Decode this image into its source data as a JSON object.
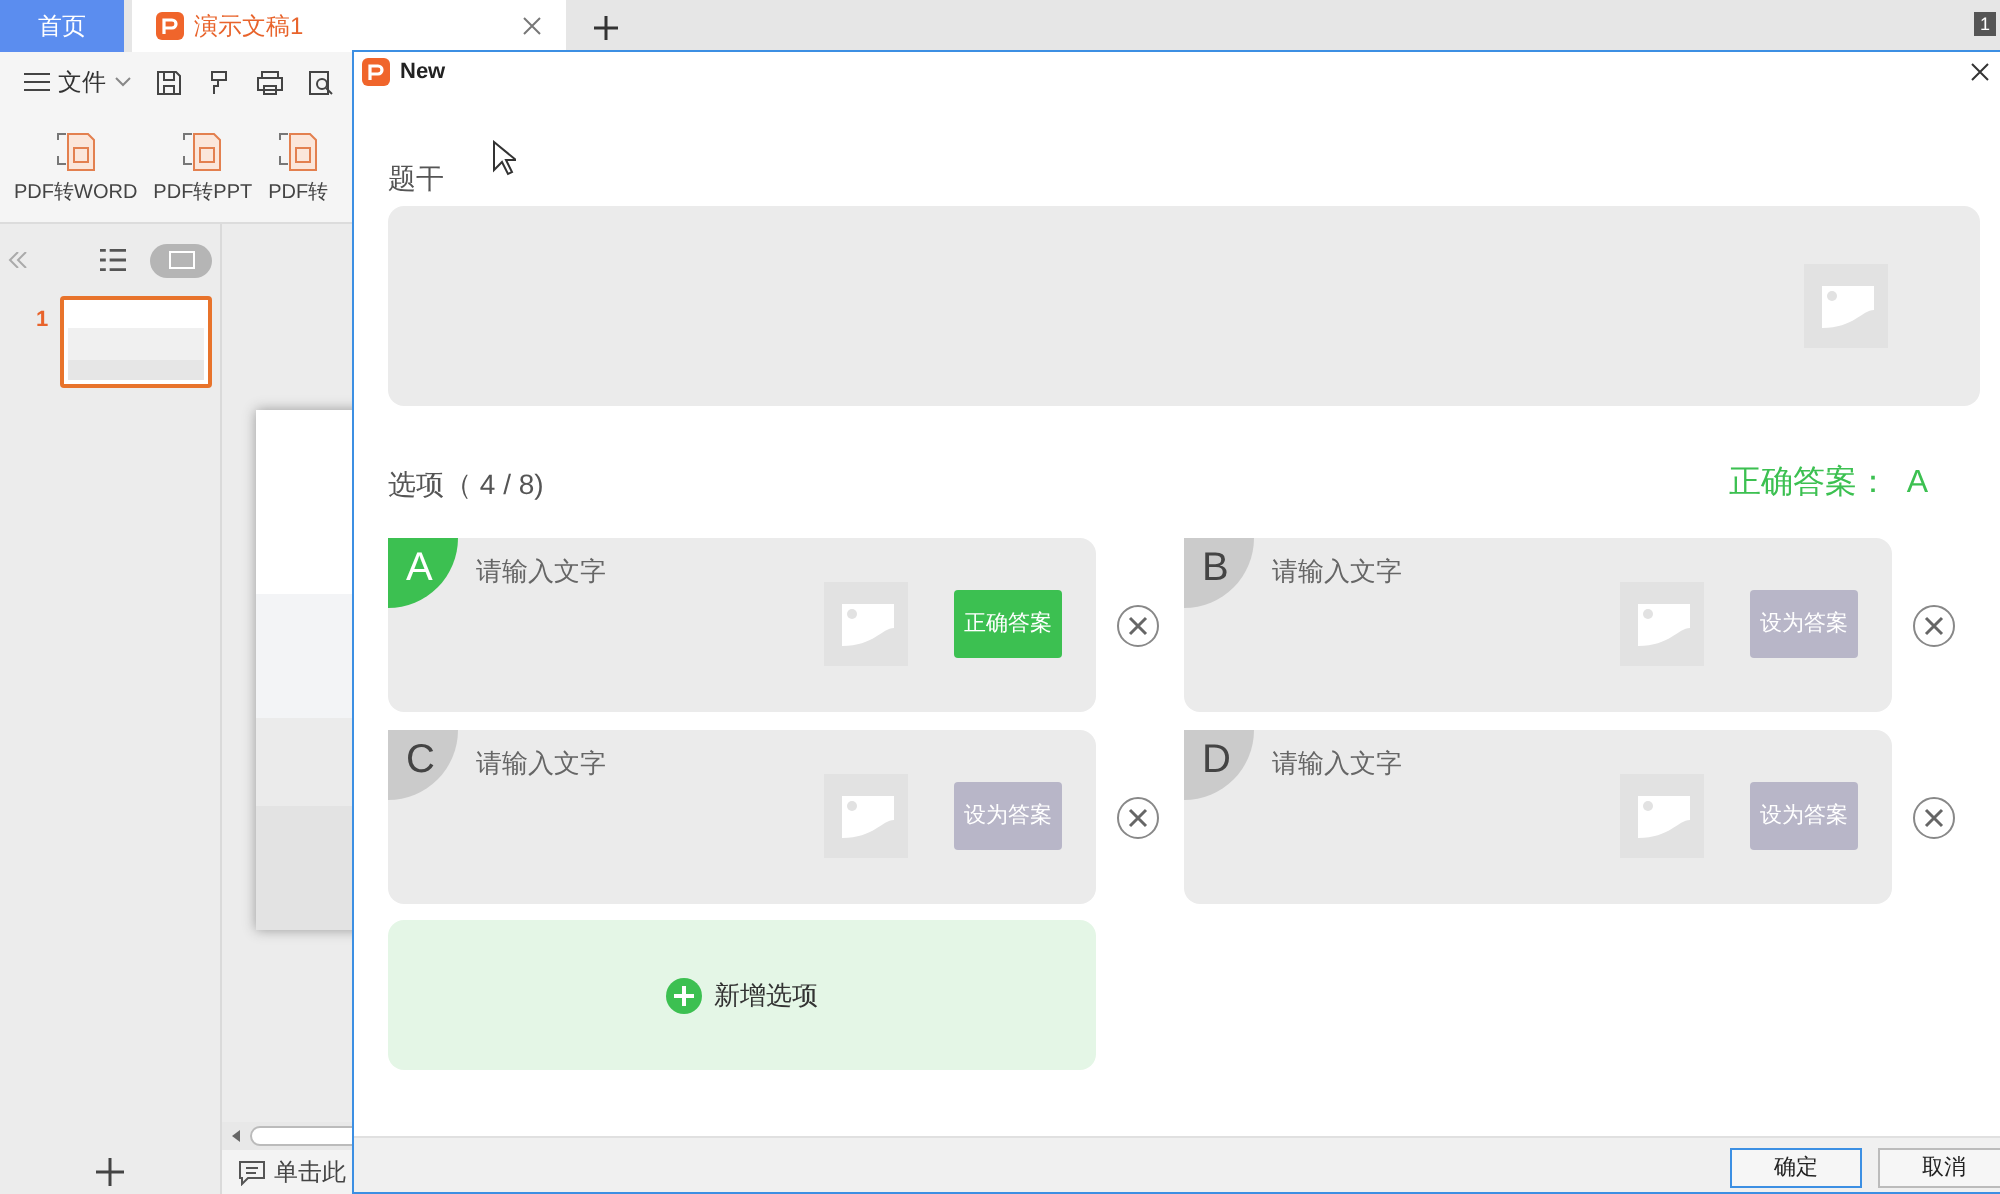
{
  "app_tabs": [
    {
      "label": "首页",
      "selected": false,
      "kind": "home"
    },
    {
      "label": "演示文稿1",
      "selected": true,
      "kind": "doc"
    }
  ],
  "window_count": "1",
  "toolbar": {
    "file_menu": "文件"
  },
  "ribbon": [
    {
      "label": "PDF转WORD"
    },
    {
      "label": "PDF转PPT"
    },
    {
      "label": "PDF转"
    }
  ],
  "slides": [
    {
      "number": "1",
      "selected": true
    }
  ],
  "notes_hint": "单击此",
  "dialog": {
    "title": "New",
    "stem_label": "题干",
    "options_label": "选项（ 4 / 8)",
    "correct_answer": "正确答案：  A",
    "options": [
      {
        "letter": "A",
        "placeholder": "请输入文字",
        "selected": true,
        "button": "正确答案"
      },
      {
        "letter": "B",
        "placeholder": "请输入文字",
        "selected": false,
        "button": "设为答案"
      },
      {
        "letter": "C",
        "placeholder": "请输入文字",
        "selected": false,
        "button": "设为答案"
      },
      {
        "letter": "D",
        "placeholder": "请输入文字",
        "selected": false,
        "button": "设为答案"
      }
    ],
    "add_option": "新增选项",
    "buttons": [
      {
        "label": "确定",
        "kind": "primary"
      },
      {
        "label": "取消",
        "kind": "secondary"
      }
    ]
  }
}
